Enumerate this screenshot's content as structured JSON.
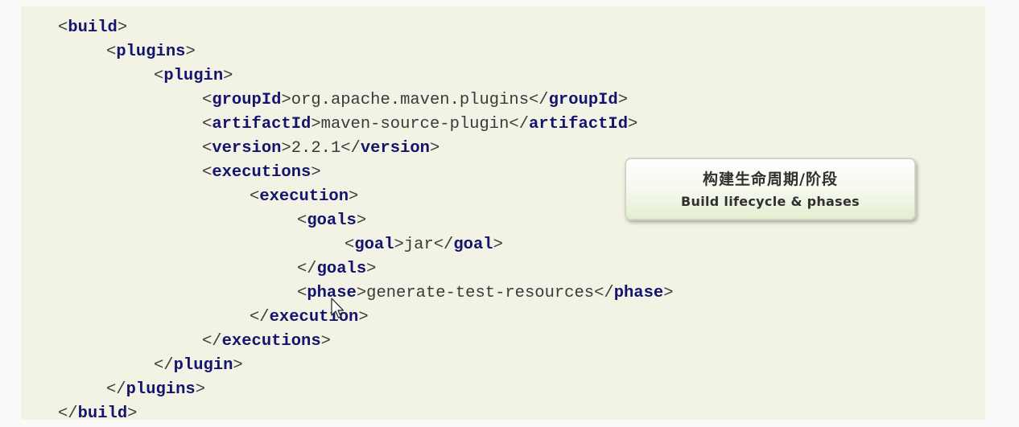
{
  "xml": {
    "open_build": "build",
    "open_plugins": "plugins",
    "open_plugin": "plugin",
    "group_tag": "groupId",
    "group_value": "org.apache.maven.plugins",
    "artifact_tag": "artifactId",
    "artifact_value": "maven-source-plugin",
    "version_tag": "version",
    "version_value": "2.2.1",
    "executions_tag": "executions",
    "execution_tag": "execution",
    "goals_tag": "goals",
    "goal_tag": "goal",
    "goal_value": "jar",
    "phase_tag": "phase",
    "phase_value": "generate-test-resources"
  },
  "callout": {
    "title_zh": "构建生命周期/阶段",
    "title_en": "Build lifecycle & phases"
  },
  "cursor_icon": "mouse-pointer-icon"
}
